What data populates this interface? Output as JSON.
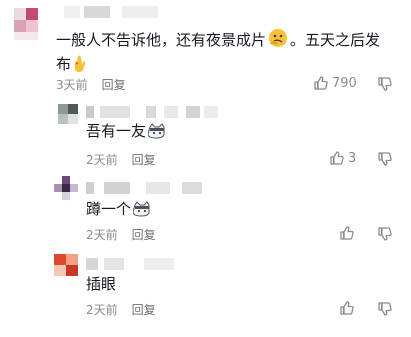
{
  "comments": [
    {
      "text_line1": "一般人不告诉他，还有夜景成片",
      "text_line1_tail": "。五天之后发",
      "text_line2": "布",
      "time": "3天前",
      "reply_label": "回复",
      "likes": "790"
    },
    {
      "text": "吾有一友",
      "time": "2天前",
      "reply_label": "回复",
      "likes": "3"
    },
    {
      "text": "蹲一个",
      "time": "2天前",
      "reply_label": "回复",
      "likes": ""
    },
    {
      "text": "插眼",
      "time": "2天前",
      "reply_label": "回复",
      "likes": ""
    }
  ],
  "icons": {
    "like": "thumbs-up-icon",
    "dislike": "thumbs-down-icon",
    "emoji_thinking": "thinking-face-emoji",
    "emoji_cross_fingers": "crossed-fingers-emoji",
    "emoji_cat": "cat-face-emoji"
  },
  "colors": {
    "text": "#161823",
    "meta": "#8a8b91",
    "reply": "#6d6e75"
  }
}
